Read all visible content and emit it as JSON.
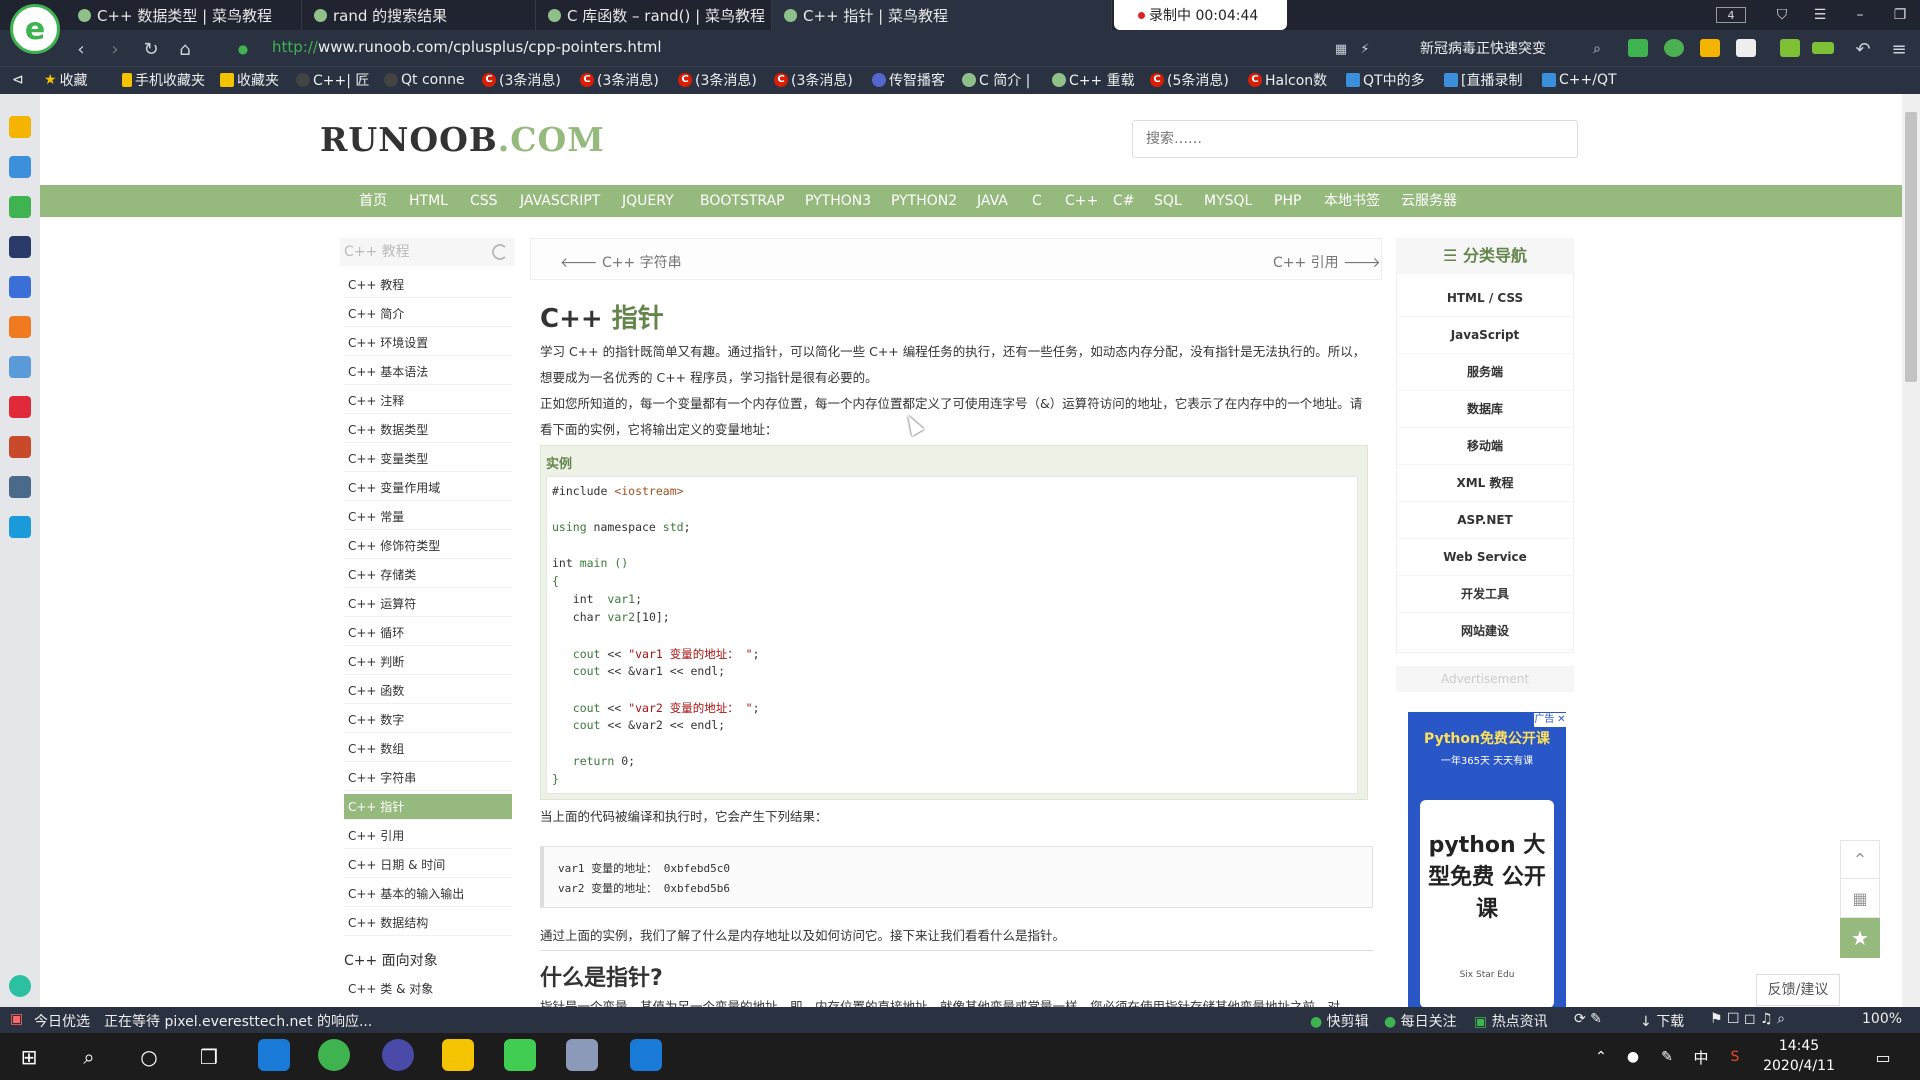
{
  "browser": {
    "tabs": [
      {
        "title": "C++ 数据类型 | 菜鸟教程"
      },
      {
        "title": "rand 的搜索结果"
      },
      {
        "title": "C 库函数 – rand() | 菜鸟教程"
      },
      {
        "title": "C++ 指针 | 菜鸟教程"
      }
    ],
    "recording": "录制中 00:04:44",
    "tab_count": "4",
    "url_protocol": "http://",
    "url_rest": "www.runoob.com/cplusplus/cpp-pointers.html",
    "news_text": "新冠病毒正快速突变",
    "bookmarks": [
      "收藏",
      "手机收藏夹",
      "收藏夹",
      "C++| 匠",
      "Qt conne",
      "(3条消息)",
      "(3条消息)",
      "(3条消息)",
      "(3条消息)",
      "传智播客",
      "C 简介 |",
      "C++ 重载",
      "(5条消息)",
      "Halcon数",
      "QT中的多",
      "[直播录制",
      "C++/QT"
    ]
  },
  "site": {
    "logo_main": "RUNOOB",
    "logo_dot": ".COM",
    "search_placeholder": "搜索……",
    "nav": [
      "首页",
      "HTML",
      "CSS",
      "JAVASCRIPT",
      "JQUERY",
      "BOOTSTRAP",
      "PYTHON3",
      "PYTHON2",
      "JAVA",
      "C",
      "C++",
      "C#",
      "SQL",
      "MYSQL",
      "PHP",
      "本地书签",
      "云服务器"
    ]
  },
  "sidebar": {
    "header": "C++ 教程",
    "items": [
      "C++ 教程",
      "C++ 简介",
      "C++ 环境设置",
      "C++ 基本语法",
      "C++ 注释",
      "C++ 数据类型",
      "C++ 变量类型",
      "C++ 变量作用域",
      "C++ 常量",
      "C++ 修饰符类型",
      "C++ 存储类",
      "C++ 运算符",
      "C++ 循环",
      "C++ 判断",
      "C++ 函数",
      "C++ 数字",
      "C++ 数组",
      "C++ 字符串",
      "C++ 指针",
      "C++ 引用",
      "C++ 日期 & 时间",
      "C++ 基本的输入输出",
      "C++ 数据结构"
    ],
    "active_index": 18,
    "section2": "C++ 面向对象",
    "section2_items": [
      "C++ 类 & 对象"
    ]
  },
  "article": {
    "prev": "C++ 字符串",
    "next": "C++ 引用",
    "title_a": "C++",
    "title_b": "指针",
    "para1": "学习 C++ 的指针既简单又有趣。通过指针，可以简化一些 C++ 编程任务的执行，还有一些任务，如动态内存分配，没有指针是无法执行的。所以，想要成为一名优秀的 C++ 程序员，学习指针是很有必要的。",
    "para2": "正如您所知道的，每一个变量都有一个内存位置，每一个内存位置都定义了可使用连字号（&）运算符访问的地址，它表示了在内存中的一个地址。请看下面的实例，它将输出定义的变量地址：",
    "example_label": "实例",
    "after_code": "当上面的代码被编译和执行时，它会产生下列结果：",
    "output": [
      "var1 变量的地址： 0xbfebd5c0",
      "var2 变量的地址： 0xbfebd5b6"
    ],
    "para3": "通过上面的实例，我们了解了什么是内存地址以及如何访问它。接下来让我们看看什么是指针。",
    "h2": "什么是指针?",
    "para4": "指针是一个变量，其值为另一个变量的地址，即，内存位置的直接地址。就像其他变量或常量一样，您必须在使用指针存储其他变量地址之前，对"
  },
  "right_nav": {
    "header": "分类导航",
    "items": [
      "HTML / CSS",
      "JavaScript",
      "服务端",
      "数据库",
      "移动端",
      "XML 教程",
      "ASP.NET",
      "Web Service",
      "开发工具",
      "网站建设"
    ],
    "ad_label": "Advertisement"
  },
  "ad": {
    "top": "Python免费公开课",
    "sub": "一年365天 天天有课",
    "text": "python 大型免费 公开课",
    "brand": "Six Star Edu",
    "close": "广告 ✕"
  },
  "feedback": "反馈/建议",
  "status_bar": {
    "left": "今日优选",
    "loading": "正在等待 pixel.everesttech.net 的响应...",
    "items": [
      "快剪辑",
      "每日关注",
      "热点资讯",
      "下载",
      "100%"
    ]
  },
  "taskbar": {
    "time": "14:45",
    "date": "2020/4/11",
    "ime": "中"
  }
}
